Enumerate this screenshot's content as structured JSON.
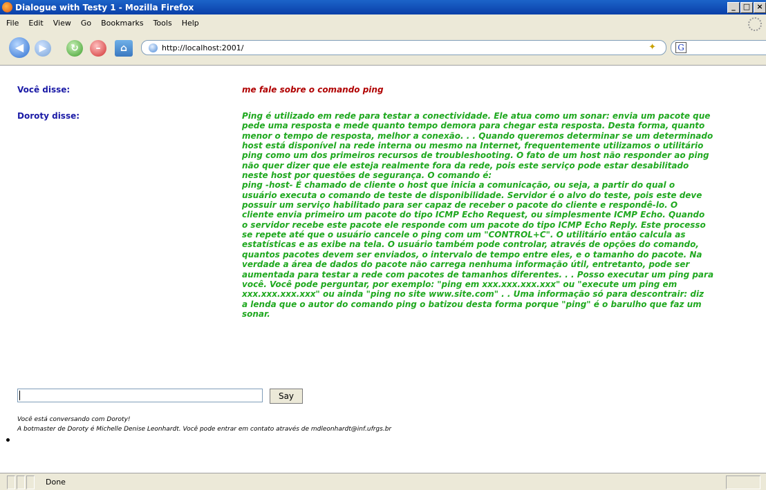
{
  "window": {
    "title": "Dialogue with Testy 1 - Mozilla Firefox",
    "min": "_",
    "max": "□",
    "close": "×"
  },
  "menu": [
    "File",
    "Edit",
    "View",
    "Go",
    "Bookmarks",
    "Tools",
    "Help"
  ],
  "toolbar": {
    "url": "http://localhost:2001/",
    "search_engine_icon": "G"
  },
  "dialogue": {
    "you_label": "Você disse:",
    "you_text": "me fale sobre o comando ping",
    "bot_label": "Doroty disse:",
    "bot_lines": [
      "Ping é utilizado em rede para testar a conectividade. Ele atua como um sonar: envia um pacote que",
      "pede uma resposta e mede quanto tempo demora para chegar esta resposta. Desta forma, quanto",
      "menor o tempo de resposta, melhor a conexão. . . Quando queremos determinar se um determinado",
      "host está disponível na rede interna ou mesmo na Internet, frequentemente utilizamos o utilitário",
      "ping como um dos primeiros recursos de troubleshooting. O fato de um host não responder ao ping",
      "não quer dizer que ele esteja realmente fora da rede, pois este serviço pode estar desabilitado",
      "neste host por questões de segurança. O comando é:",
      "ping -host- É chamado de cliente o host que inicia a comunicação, ou seja, a partir do qual o",
      "usuário executa o comando de teste de disponibilidade. Servidor é o alvo do teste, pois este deve",
      "possuir um serviço habilitado para ser capaz de receber o pacote do cliente e respondê-lo. O",
      "cliente envia primeiro um pacote do tipo ICMP Echo Request, ou simplesmente ICMP Echo. Quando",
      "o servidor recebe este pacote ele responde com um pacote do tipo ICMP Echo Reply. Este processo",
      "se repete até que o usuário cancele o ping com um \"CONTROL+C\". O utilitário então calcula as",
      "estatísticas e as exibe na tela. O usuário também pode controlar, através de opções do comando,",
      "quantos pacotes devem ser enviados, o intervalo de tempo entre eles, e o tamanho do pacote. Na",
      "verdade a área de dados do pacote não carrega nenhuma informação útil, entretanto, pode ser",
      "aumentada para testar a rede com pacotes de tamanhos diferentes. . . Posso executar um ping para",
      "você. Você pode perguntar, por exemplo: \"ping em xxx.xxx.xxx.xxx\" ou \"execute um ping em",
      "xxx.xxx.xxx.xxx\" ou ainda \"ping no site www.site.com\" . . Uma informação só para descontrair: diz",
      "a lenda que o autor do comando ping o batizou desta forma porque \"ping\" é o barulho que faz um",
      "sonar."
    ]
  },
  "form": {
    "input_value": "",
    "say_label": "Say"
  },
  "footer": {
    "line1": "Você está conversando com Doroty!",
    "line2": "A botmaster de Doroty é Michelle Denise Leonhardt. Você pode entrar em contato através de mdleonhardt@inf.ufrgs.br"
  },
  "status": {
    "text": "Done"
  }
}
